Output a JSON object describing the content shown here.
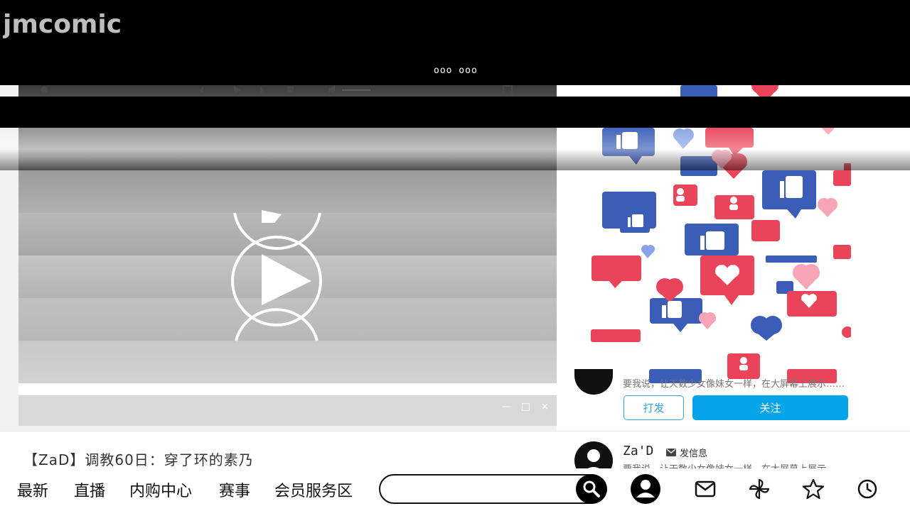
{
  "app": {
    "logo_text": "jmcomic",
    "header_dots": "ooo  ooo"
  },
  "post": {
    "title": "【ZaD】调教60日：穿了环的素乃"
  },
  "author_card": {
    "intro": "要我说，让天数少女像妹女一样，在大屏幕上展示……",
    "tip_label": "打发",
    "follow_label": "关注"
  },
  "author2": {
    "name": "Za'D",
    "message_label": "发信息",
    "intro": "要我说，让天数少女像妹女一样，在大屏幕上展示……"
  },
  "nav": {
    "links": [
      "最新",
      "直播",
      "内购中心",
      "赛事",
      "会员服务区"
    ],
    "search_placeholder": ""
  },
  "icons": {
    "search": "search-icon",
    "user": "user-icon",
    "mail": "mail-icon",
    "pinwheel": "pinwheel-icon",
    "star": "star-icon",
    "history": "clock-icon"
  },
  "colors": {
    "accent": "#06a5ea",
    "like_blue": "#3b5db8",
    "heart_red": "#e9445a",
    "heart_pink": "#f7a5b6"
  }
}
